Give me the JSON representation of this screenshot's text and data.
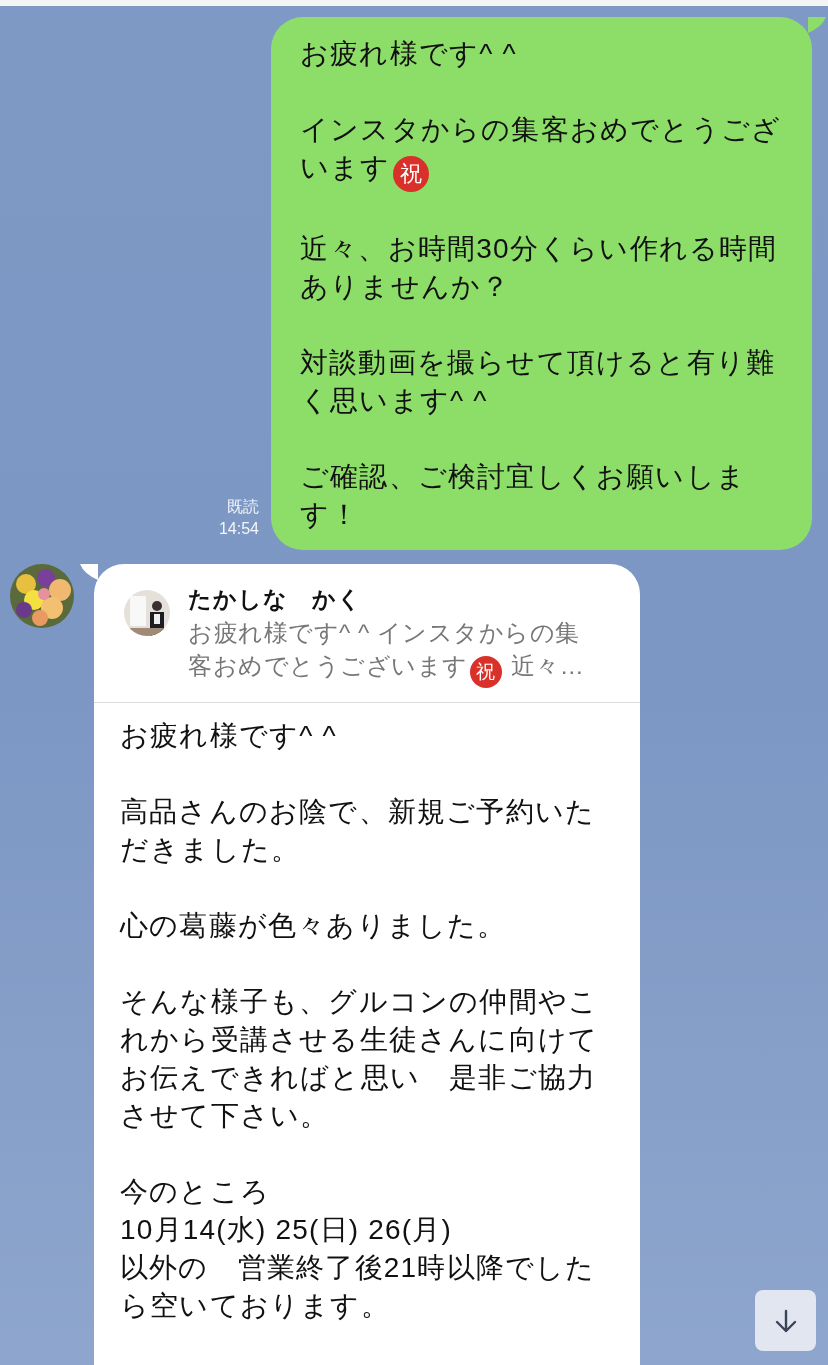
{
  "outgoing": {
    "paragraphs": [
      [
        {
          "kind": "text",
          "text": "お疲れ様です^ ^"
        }
      ],
      [
        {
          "kind": "text",
          "text": "インスタからの集客おめでとうございます"
        },
        {
          "kind": "badge",
          "text": "祝"
        }
      ],
      [
        {
          "kind": "text",
          "text": "近々、お時間30分くらい作れる時間ありませんか？"
        }
      ],
      [
        {
          "kind": "text",
          "text": "対談動画を撮らせて頂けると有り難く思います^ ^"
        }
      ],
      [
        {
          "kind": "text",
          "text": "ご確認、ご検討宜しくお願いします！"
        }
      ]
    ],
    "read_label": "既読",
    "time": "14:54"
  },
  "incoming": {
    "reply_quote": {
      "name": "たかしな　かく",
      "preview": [
        {
          "kind": "text",
          "text": "お疲れ様です^ ^ インスタからの集客おめでとうございます"
        },
        {
          "kind": "badge",
          "text": "祝"
        },
        {
          "kind": "text",
          "text": " 近々…"
        }
      ]
    },
    "paragraphs": [
      [
        {
          "kind": "text",
          "text": "お疲れ様です^ ^"
        }
      ],
      [
        {
          "kind": "text",
          "text": "高品さんのお陰で、新規ご予約いただきました。"
        }
      ],
      [
        {
          "kind": "text",
          "text": "心の葛藤が色々ありました。"
        }
      ],
      [
        {
          "kind": "text",
          "text": "そんな様子も、グルコンの仲間やこれから受講させる生徒さんに向けてお伝えできればと思い　是非ご協力させて下さい。"
        }
      ],
      [
        {
          "kind": "text",
          "text": "今のところ\n10月14(水) 25(日) 26(月)\n以外の　営業終了後21時以降でしたら空いております。"
        }
      ]
    ]
  }
}
